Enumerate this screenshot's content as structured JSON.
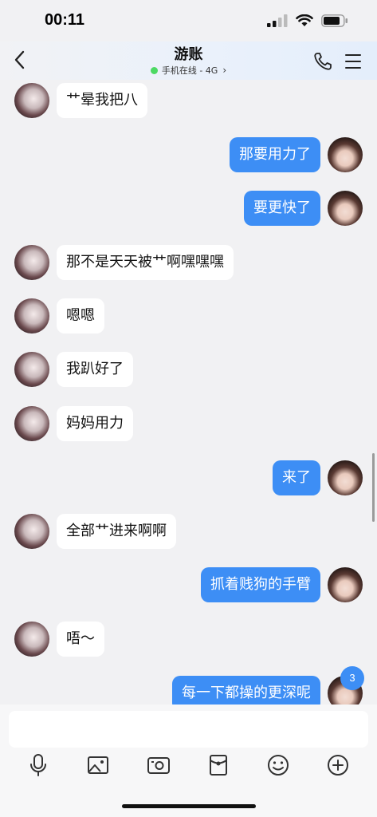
{
  "status": {
    "time": "00:11"
  },
  "header": {
    "title": "游账",
    "subtitle": "手机在线 - 4G"
  },
  "messages": [
    {
      "side": "left",
      "text": "艹晕我把八"
    },
    {
      "side": "right",
      "text": "那要用力了"
    },
    {
      "side": "right",
      "text": "要更快了"
    },
    {
      "side": "left",
      "text": "那不是天天被艹啊嘿嘿嘿"
    },
    {
      "side": "left",
      "text": "嗯嗯"
    },
    {
      "side": "left",
      "text": "我趴好了"
    },
    {
      "side": "left",
      "text": "妈妈用力"
    },
    {
      "side": "right",
      "text": "来了"
    },
    {
      "side": "left",
      "text": "全部艹进来啊啊"
    },
    {
      "side": "right",
      "text": "抓着贱狗的手臂"
    },
    {
      "side": "left",
      "text": "唔～"
    },
    {
      "side": "right",
      "text": "每一下都操的更深呢"
    }
  ],
  "unread_badge": "3",
  "icons": {
    "back": "chevron-left-icon",
    "call": "phone-icon",
    "menu": "hamburger-menu-icon",
    "toolbar": [
      "microphone-icon",
      "image-icon",
      "camera-icon",
      "red-packet-icon",
      "emoji-icon",
      "plus-circle-icon"
    ]
  },
  "colors": {
    "accent": "#3d8ef5",
    "online": "#4cd964",
    "chat_bg": "#f1f1f3"
  }
}
